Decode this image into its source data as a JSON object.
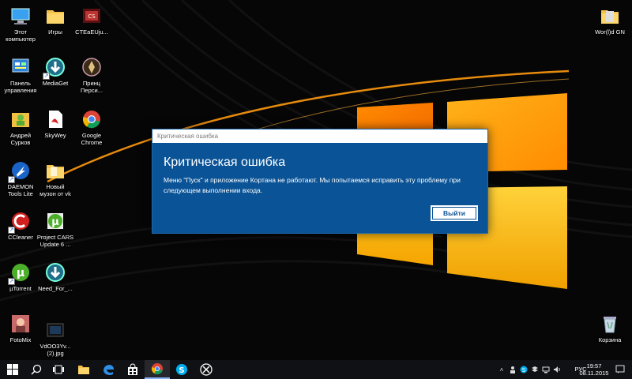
{
  "desktop": {
    "icons": [
      {
        "label": "Этот\nкомпьютер",
        "icon": "computer-icon"
      },
      {
        "label": "Игры",
        "icon": "folder-icon"
      },
      {
        "label": "CTEaEUju...",
        "icon": "game-icon"
      },
      {
        "label": "Панель\nуправления",
        "icon": "control-panel-icon"
      },
      {
        "label": "MediaGet",
        "icon": "mediaget-icon"
      },
      {
        "label": "Принц\nПерси...",
        "icon": "prince-icon"
      },
      {
        "label": "Андрей\nСурков",
        "icon": "user-folder-icon"
      },
      {
        "label": "SkyWey",
        "icon": "pdf-icon"
      },
      {
        "label": "Google\nChrome",
        "icon": "chrome-icon"
      },
      {
        "label": "DAEMON\nTools Lite",
        "icon": "daemon-tools-icon"
      },
      {
        "label": "Новый\nмузон от vk",
        "icon": "folder-icon"
      },
      {
        "label": "CCleaner",
        "icon": "ccleaner-icon"
      },
      {
        "label": "Project CARS\nUpdate 6 ...",
        "icon": "utorrent-icon"
      },
      {
        "label": "µTorrent",
        "icon": "utorrent-icon"
      },
      {
        "label": "Need_For_...",
        "icon": "mediaget-icon"
      },
      {
        "label": "FotoMix",
        "icon": "fotomix-icon"
      },
      {
        "label": "VdOO3Yv...\n(2).jpg",
        "icon": "image-file-icon"
      },
      {
        "label": "Wor(l)d GN",
        "icon": "folder-icon"
      },
      {
        "label": "Корзина",
        "icon": "recycle-bin-icon"
      }
    ]
  },
  "dialog": {
    "window_title": "Критическая ошибка",
    "heading": "Критическая ошибка",
    "message": "Меню \"Пуск\" и приложение Кортана не работают. Мы попытаемся исправить эту проблему при следующем выполнении входа.",
    "button_label": "Выйти",
    "background_color": "#0a5396"
  },
  "taskbar": {
    "pinned": [
      "start-icon",
      "search-icon",
      "task-view-icon",
      "file-explorer-icon",
      "edge-icon",
      "store-icon",
      "chrome-icon",
      "skype-icon",
      "xbox-icon"
    ],
    "tray_icons": [
      "chevron-up-icon",
      "people-icon",
      "skype-tray-icon",
      "dropbox-icon",
      "network-icon",
      "volume-icon"
    ],
    "language": "РУС",
    "time": "19:57",
    "date": "08.11.2015"
  }
}
